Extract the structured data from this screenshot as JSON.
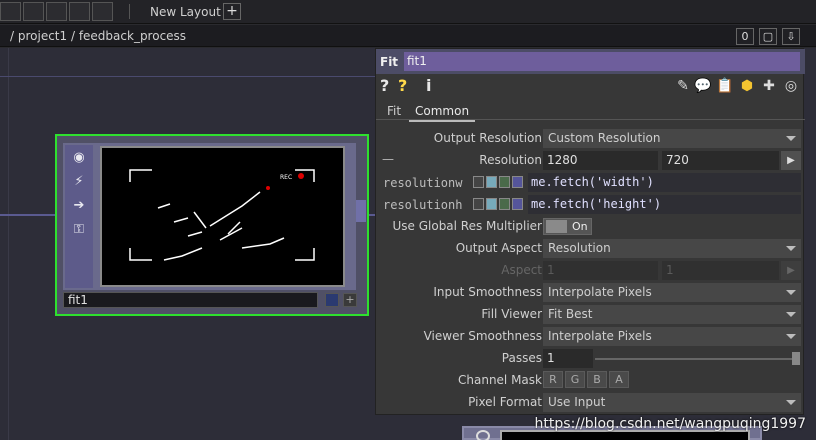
{
  "toolbar": {
    "new_layout_label": "New Layout",
    "add_label": "+"
  },
  "pathbar": {
    "path": "/ project1 / feedback_process",
    "btn_zero": "0",
    "btn_window": "▢",
    "btn_down": "⇩"
  },
  "node": {
    "name": "fit1",
    "viewer_rec": "REC"
  },
  "panel": {
    "type": "Fit",
    "name": "fit1",
    "toolbar_left": [
      "?",
      "?",
      "i"
    ],
    "tabs": [
      "Fit",
      "Common"
    ],
    "active_tab": "Common",
    "params": {
      "output_resolution": {
        "label": "Output Resolution",
        "value": "Custom Resolution"
      },
      "resolution": {
        "label": "Resolution",
        "w": "1280",
        "h": "720",
        "dash": "—"
      },
      "resolutionw": {
        "label": "resolutionw",
        "expr": "me.fetch('width')"
      },
      "resolutionh": {
        "label": "resolutionh",
        "expr": "me.fetch('height')"
      },
      "global_res": {
        "label": "Use Global Res Multiplier",
        "value": "On"
      },
      "output_aspect": {
        "label": "Output Aspect",
        "value": "Resolution"
      },
      "aspect": {
        "label": "Aspect",
        "a": "1",
        "b": "1"
      },
      "input_smoothness": {
        "label": "Input Smoothness",
        "value": "Interpolate Pixels"
      },
      "fill_viewer": {
        "label": "Fill Viewer",
        "value": "Fit Best"
      },
      "viewer_smoothness": {
        "label": "Viewer Smoothness",
        "value": "Interpolate Pixels"
      },
      "passes": {
        "label": "Passes",
        "value": "1"
      },
      "channel_mask": {
        "label": "Channel Mask",
        "channels": [
          "R",
          "G",
          "B",
          "A"
        ]
      },
      "pixel_format": {
        "label": "Pixel Format",
        "value": "Use Input"
      }
    }
  },
  "watermark": "https://blog.csdn.net/wangpuqing1997"
}
